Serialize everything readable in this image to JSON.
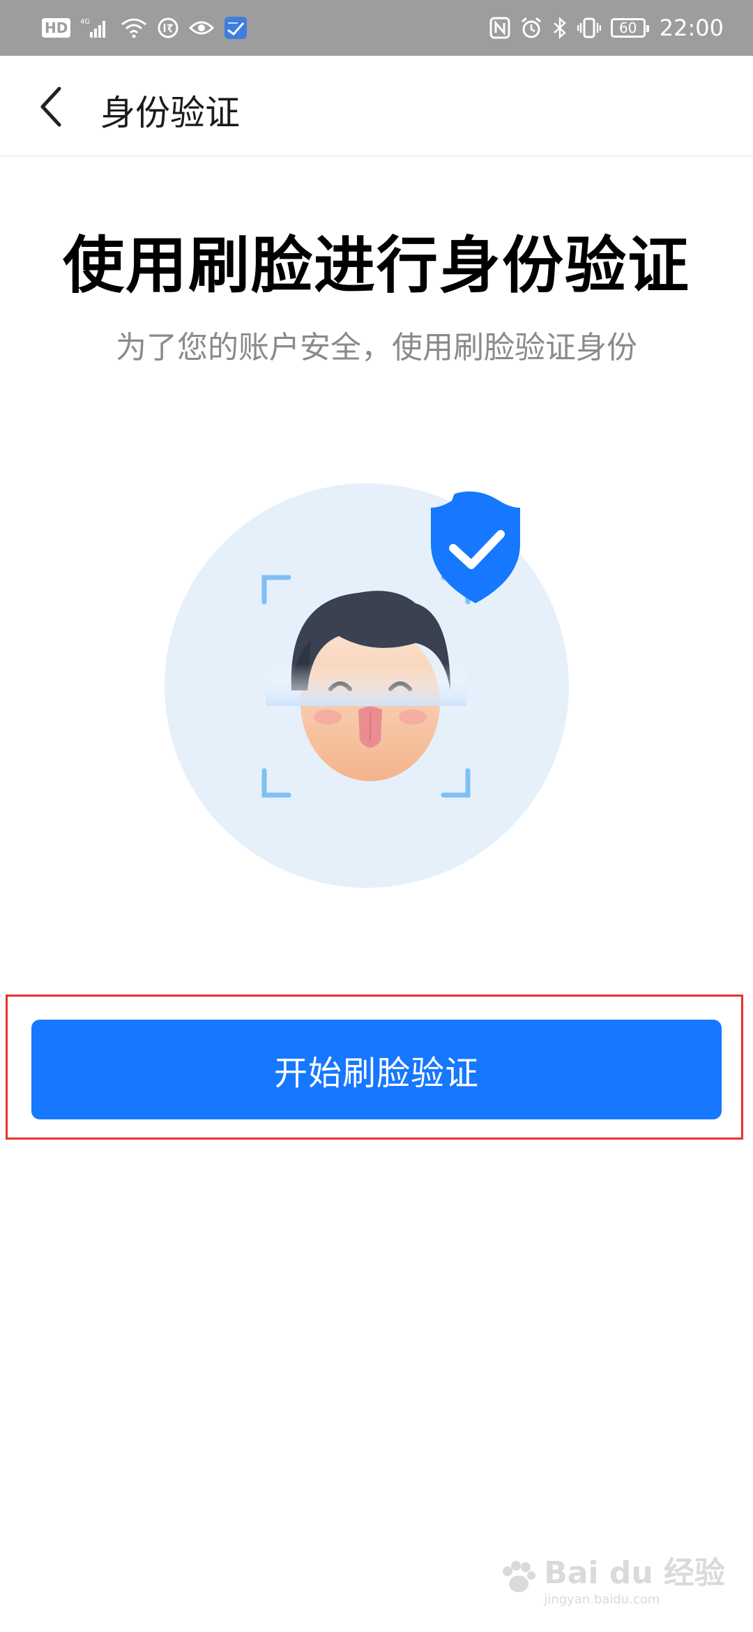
{
  "status_bar": {
    "hd": "HD",
    "network": "4G",
    "battery": "60",
    "time": "22:00"
  },
  "header": {
    "title": "身份验证",
    "back_icon": "chevron-left-icon"
  },
  "main": {
    "title": "使用刷脸进行身份验证",
    "subtitle": "为了您的账户安全，使用刷脸验证身份"
  },
  "illustration": {
    "icons": [
      "face-scan-icon",
      "shield-check-icon"
    ],
    "colors": {
      "circle": "#e6f0fb",
      "shield": "#1677ff",
      "frame": "#7ec0f5",
      "hair": "#3a4150",
      "skin": "#f7c9a5"
    }
  },
  "action": {
    "start_label": "开始刷脸验证"
  },
  "watermark": {
    "text": "Bai du 经验",
    "url": "jingyan.baidu.com"
  },
  "colors": {
    "accent": "#1677ff",
    "highlight_border": "#e8312d",
    "status_bar": "#9d9d9d"
  }
}
